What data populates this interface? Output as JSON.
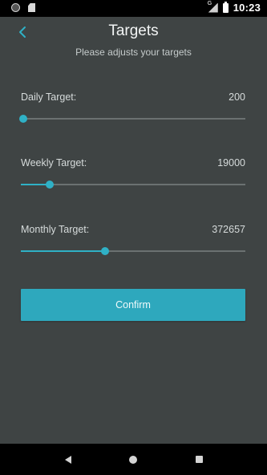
{
  "status_bar": {
    "time": "10:23",
    "network_label": "G",
    "icons": [
      "notification-circle-icon",
      "sd-card-icon",
      "signal-icon",
      "battery-icon"
    ]
  },
  "header": {
    "title": "Targets",
    "subtitle": "Please adjusts your targets",
    "back_icon": "chevron-left-icon"
  },
  "targets": [
    {
      "label": "Daily Target:",
      "value": "200",
      "level": 0.01
    },
    {
      "label": "Weekly Target:",
      "value": "19000",
      "level": 0.13
    },
    {
      "label": "Monthly Target:",
      "value": "372657",
      "level": 0.375
    }
  ],
  "confirm": {
    "label": "Confirm"
  },
  "nav_bar": {
    "icons": [
      "back-triangle-icon",
      "home-circle-icon",
      "recents-square-icon"
    ]
  },
  "colors": {
    "background": "#3f4444",
    "accent": "#2fb1c6",
    "button": "#2ea8bd",
    "track": "#6b7171"
  }
}
